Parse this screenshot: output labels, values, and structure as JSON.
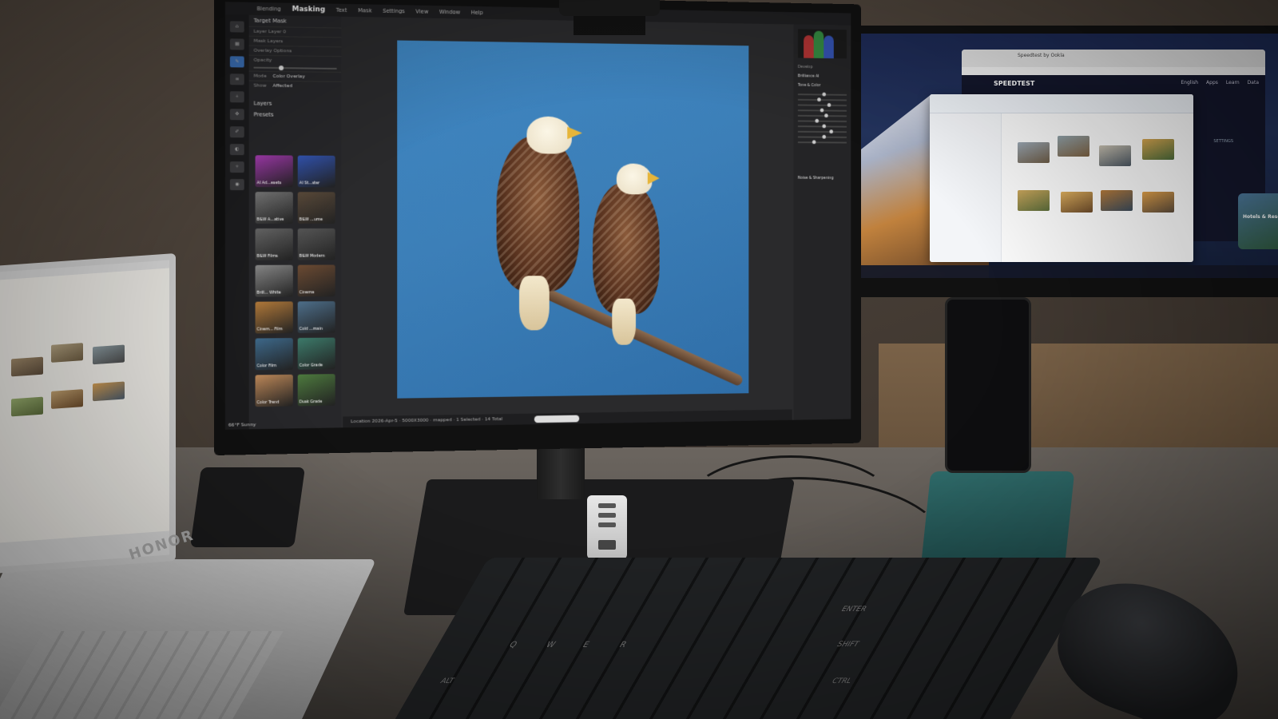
{
  "main_app": {
    "menu": [
      "Blending",
      "Masking",
      "Text",
      "Mask",
      "Settings",
      "View",
      "Window",
      "Help"
    ],
    "active_menu": "Masking",
    "panel": {
      "target_mask": "Target Mask",
      "layer": "Layer Layer 0",
      "mask_layers": "Mask Layers",
      "overlay_options": "Overlay Options",
      "opacity": "Opacity",
      "mode_label": "Mode",
      "mode_value": "Color Overlay",
      "show_label": "Show",
      "show_value": "Affected",
      "layers": "Layers",
      "presets": "Presets"
    },
    "presets": [
      {
        "label": "AI Ad...esets",
        "color": "#a43bb0"
      },
      {
        "label": "AI St...ster",
        "color": "#3355b3"
      },
      {
        "label": "B&W A...ative",
        "color": "#777777"
      },
      {
        "label": "B&W ...ume",
        "color": "#5a4a3a"
      },
      {
        "label": "B&W Films",
        "color": "#666666"
      },
      {
        "label": "B&W Modern",
        "color": "#555555"
      },
      {
        "label": "Brill... White",
        "color": "#888888"
      },
      {
        "label": "Cinema",
        "color": "#6b4a32"
      },
      {
        "label": "Cinem... Film",
        "color": "#b37a3a"
      },
      {
        "label": "Cold ...main",
        "color": "#4d6e8a"
      },
      {
        "label": "Color Film",
        "color": "#3e6a8c"
      },
      {
        "label": "Color Grade",
        "color": "#3c7a6a"
      },
      {
        "label": "Color Trend",
        "color": "#c08a5a"
      },
      {
        "label": "Dusk Grade",
        "color": "#4d7a3e"
      }
    ],
    "right_panel": {
      "develop": "Develop",
      "brilliance": "Brilliance AI",
      "tone_color": "Tone & Color",
      "noise": "Noise & Sharpening"
    },
    "status": "Location 2026-Apr-5 · 5000X3000 · mapped · 1 Selected · 14 Total",
    "weather": "66°F Sunny",
    "histogram_colors": [
      "#d23a3a",
      "#3aa24a",
      "#3a5fd2"
    ]
  },
  "second_monitor": {
    "browser_title": "Speedtest by Ookla",
    "site_logo": "SPEEDTEST",
    "nav": [
      "English",
      "Apps",
      "Learn",
      "Data"
    ],
    "card_text": "Hotels & Resorts",
    "settings_text": "SETTINGS"
  },
  "laptop": {
    "brand": "HONOR"
  },
  "keyboard": {
    "keys": [
      "ENTER",
      "SHIFT",
      "CTRL",
      "ALT",
      "Q",
      "W",
      "E",
      "R"
    ]
  }
}
